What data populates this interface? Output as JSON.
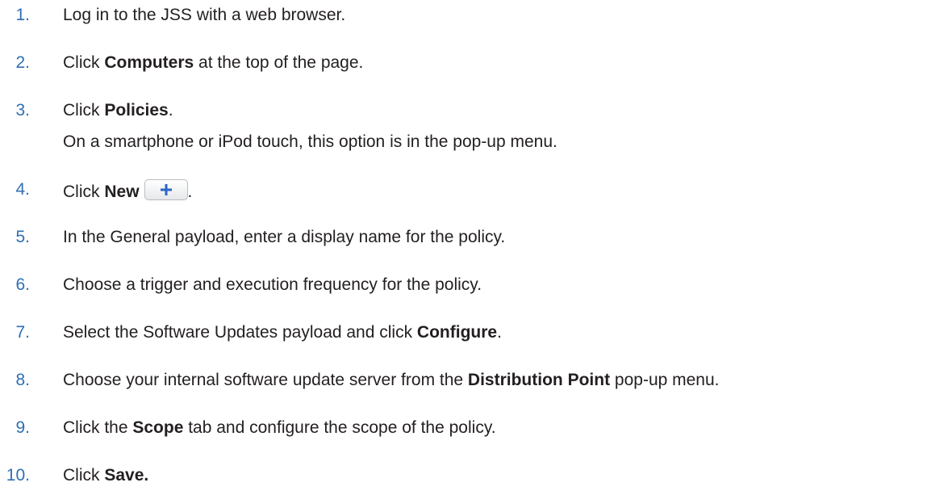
{
  "steps": [
    {
      "num": "1.",
      "text": "Log in to the JSS with a web browser."
    },
    {
      "num": "2.",
      "pre": "Click ",
      "bold": "Computers",
      "post": " at the top of the page."
    },
    {
      "num": "3.",
      "pre": "Click ",
      "bold": "Policies",
      "post": ".",
      "note": "On a smartphone or iPod touch, this option is in the pop-up menu."
    },
    {
      "num": "4.",
      "pre": "Click ",
      "bold": "New",
      "post": ".",
      "icon": "plus-icon"
    },
    {
      "num": "5.",
      "text": "In the General payload, enter a display name for the policy."
    },
    {
      "num": "6.",
      "text": "Choose a trigger and execution frequency for the policy."
    },
    {
      "num": "7.",
      "pre": "Select the Software Updates payload and click ",
      "bold": "Configure",
      "post": "."
    },
    {
      "num": "8.",
      "pre": "Choose your internal software update server from the ",
      "bold": "Distribution Point",
      "post": " pop-up menu."
    },
    {
      "num": "9.",
      "pre": "Click the ",
      "bold": "Scope",
      "post": " tab and configure the scope of the policy."
    },
    {
      "num": "10.",
      "pre": "Click ",
      "bold": "Save."
    }
  ],
  "colors": {
    "number": "#2f6fb5",
    "text": "#231f20",
    "plus": "#2b66c7"
  }
}
